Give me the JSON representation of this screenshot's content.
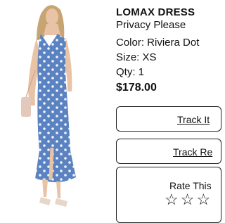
{
  "product": {
    "title": "LOMAX DRESS",
    "brand": "Privacy Please",
    "color": "Color: Riviera Dot",
    "size": "Size: XS",
    "qty": "Qty: 1",
    "price": "$178.00"
  },
  "actions": {
    "track_item": "Track It",
    "track_return": "Track Re",
    "rate_label": "Rate This",
    "stars": "☆☆☆"
  },
  "colors": {
    "dress": "#5b83c2",
    "dot": "#f3f5fb",
    "skin": "#e8c3a6",
    "hair": "#c8a472",
    "bag": "#e3c9bb"
  }
}
